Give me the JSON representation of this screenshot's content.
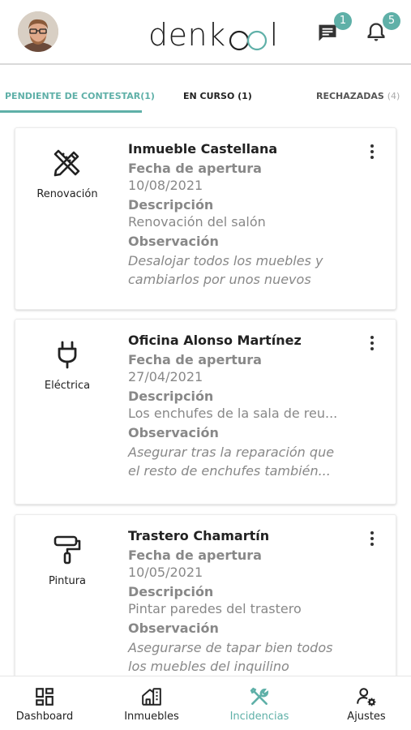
{
  "header": {
    "logo_text_left": "denk",
    "logo_text_right": "l",
    "messages_badge": "1",
    "notifications_badge": "5",
    "accent_color": "#5fb0a8"
  },
  "tabs": [
    {
      "label": "PENDIENTE DE CONTESTAR(1)",
      "active": true
    },
    {
      "label": "EN CURSO (1)",
      "active": false
    },
    {
      "label": "RECHAZADAS",
      "count": "(4)",
      "active": false
    }
  ],
  "cards": [
    {
      "category": "Renovación",
      "icon": "pencil-ruler-icon",
      "title": "Inmueble Castellana",
      "open_date_label": "Fecha de apertura",
      "open_date": "10/08/2021",
      "description_label": "Descripción",
      "description": "Renovación del salón",
      "observation_label": "Observación",
      "observation": "Desalojar todos los muebles y\ncambiarlos por unos nuevos"
    },
    {
      "category": "Eléctrica",
      "icon": "plug-icon",
      "title": "Oficina Alonso Martínez",
      "open_date_label": "Fecha de apertura",
      "open_date": "27/04/2021",
      "description_label": "Descripción",
      "description": "Los enchufes de la sala de reu...",
      "observation_label": "Observación",
      "observation": "Asegurar tras la reparación que\n el resto de enchufes también..."
    },
    {
      "category": "Pintura",
      "icon": "paint-roller-icon",
      "title": "Trastero Chamartín",
      "open_date_label": "Fecha de apertura",
      "open_date": "10/05/2021",
      "description_label": "Descripción",
      "description": "Pintar paredes del trastero",
      "observation_label": "Observación",
      "observation": "Asegurarse de tapar bien todos\nlos muebles del inquilino"
    }
  ],
  "bottom_nav": [
    {
      "label": "Dashboard",
      "icon": "dashboard-icon",
      "active": false
    },
    {
      "label": "Inmuebles",
      "icon": "building-icon",
      "active": false
    },
    {
      "label": "Incidencias",
      "icon": "tools-icon",
      "active": true
    },
    {
      "label": "Ajustes",
      "icon": "user-settings-icon",
      "active": false
    }
  ]
}
